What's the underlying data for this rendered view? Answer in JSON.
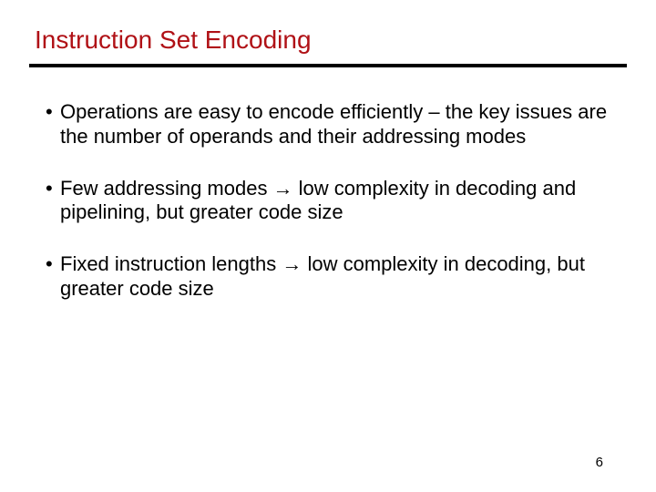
{
  "title": "Instruction Set Encoding",
  "bullets": [
    "Operations are easy to encode efficiently – the key issues are the number of operands and their addressing modes",
    "Few addressing modes → low complexity in decoding and pipelining, but greater code size",
    "Fixed instruction lengths → low complexity in decoding, but greater code size"
  ],
  "page_number": "6"
}
